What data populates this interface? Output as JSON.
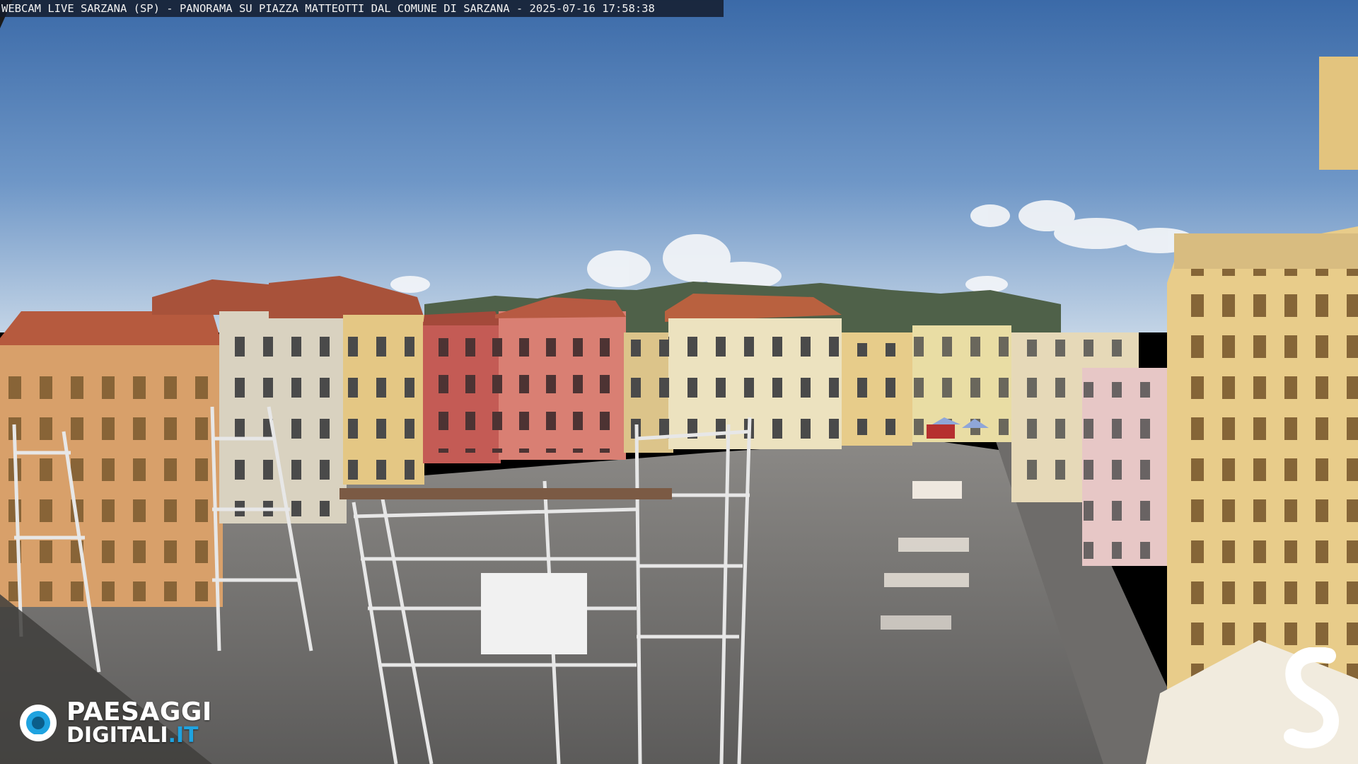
{
  "overlay": {
    "caption": "WEBCAM LIVE SARZANA (SP) - PANORAMA SU PIAZZA MATTEOTTI DAL COMUNE DI SARZANA - 2025-07-16  17:58:38"
  },
  "watermark": {
    "line1": "PAESAGGI",
    "line2_main": "DIGITALI",
    "line2_suffix": ".IT",
    "corner_letter": "S"
  },
  "colors": {
    "sky_top": "#3f6fae",
    "sky_bottom": "#b7cde3",
    "pavement": "#7c7a78",
    "accent": "#1fa3e0"
  }
}
